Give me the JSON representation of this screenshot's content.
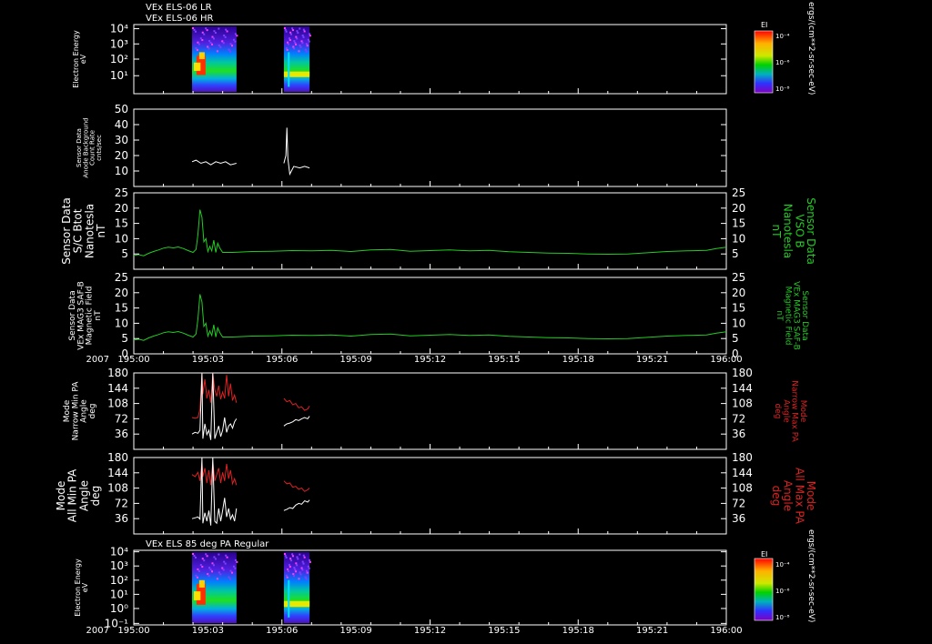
{
  "header": {
    "line1": "VEx ELS-06 LR",
    "line2": "VEx ELS-06 HR"
  },
  "x_axis": {
    "year": "2007",
    "ticks": [
      "195:00",
      "195:03",
      "195:06",
      "195:09",
      "195:12",
      "195:15",
      "195:18",
      "195:21",
      "196:00"
    ]
  },
  "colors": {
    "background": "#000000",
    "white": "#ffffff",
    "green": "#22cc22",
    "red": "#dd2222"
  },
  "colorbar": {
    "label": "EI",
    "ticks": [
      "10⁻⁴",
      "10⁻⁶",
      "10⁻⁸"
    ],
    "units": "ergs/(cm**2-sr-sec-eV)"
  },
  "panels": [
    {
      "id": "spectrogram-1",
      "ylabel": [
        "Electron Energy",
        "eV"
      ],
      "yticks": [
        "10⁴",
        "10³",
        "10²",
        "10¹"
      ]
    },
    {
      "id": "anode-background",
      "ylabel": [
        "Sensor Data",
        "Anode Background",
        "Count Rate",
        "cnts/sec"
      ],
      "yticks": [
        "50",
        "40",
        "30",
        "20",
        "10"
      ]
    },
    {
      "id": "btot",
      "ylabel": [
        "Sensor Data",
        "S/C Btot",
        "Nanotesla",
        "nT"
      ],
      "right_label": [
        "Sensor Data",
        "VSO B",
        "Nanotesla",
        "nT"
      ],
      "yticks": [
        "25",
        "20",
        "15",
        "10",
        "5"
      ]
    },
    {
      "id": "mag-saf",
      "ylabel": [
        "Sensor Data",
        "VEx MAG3 SAF-B",
        "Magnetic Field",
        "nT"
      ],
      "right_label": [
        "Sensor Data",
        "VEx MAG3 SAF-B",
        "Magnetic Field",
        "nT"
      ],
      "yticks": [
        "25",
        "20",
        "15",
        "10",
        "5",
        "0"
      ]
    },
    {
      "id": "narrow-pa",
      "ylabel": [
        "Mode",
        "Narrow Min PA",
        "Angle",
        "deg"
      ],
      "right_label": [
        "Mode",
        "Narrow Max PA",
        "Angle",
        "deg"
      ],
      "yticks": [
        "180",
        "144",
        "108",
        "72",
        "36"
      ]
    },
    {
      "id": "all-pa",
      "ylabel": [
        "Mode",
        "All Min PA",
        "Angle",
        "deg"
      ],
      "right_label": [
        "Mode",
        "All Max PA",
        "Angle",
        "deg"
      ],
      "yticks": [
        "180",
        "144",
        "108",
        "72",
        "36"
      ]
    },
    {
      "id": "spectrogram-2",
      "title": "VEx ELS 85 deg PA Regular",
      "ylabel": [
        "Electron Energy",
        "eV"
      ],
      "yticks": [
        "10⁴",
        "10³",
        "10²",
        "10¹",
        "10⁰",
        "10⁻¹"
      ]
    }
  ],
  "chart_data": [
    {
      "type": "heatmap",
      "name": "VEx ELS-06 LR / HR",
      "x_range": [
        "195:00",
        "196:00"
      ],
      "ylim_log10": [
        0,
        4
      ],
      "data_segments": [
        [
          "195:05.9",
          "195:10.4"
        ],
        [
          "195:15.2",
          "195:17.8"
        ]
      ]
    },
    {
      "type": "line",
      "ylim": [
        0,
        50
      ],
      "segments": [
        {
          "x": [
            5.9,
            6.3,
            6.8,
            7.3,
            7.8,
            8.3,
            8.8,
            9.3,
            9.8,
            10.4
          ],
          "y": [
            16,
            17,
            15,
            16,
            14,
            16,
            15,
            16,
            14,
            15
          ]
        },
        {
          "x": [
            15.2,
            15.4,
            15.5,
            15.6,
            15.8,
            16.2,
            16.8,
            17.3,
            17.8
          ],
          "y": [
            15,
            20,
            38,
            18,
            8,
            13,
            12,
            13,
            12
          ]
        }
      ]
    },
    {
      "type": "line",
      "ylim": [
        0,
        25
      ],
      "x": [
        0,
        0.5,
        1,
        1.5,
        2,
        2.5,
        3,
        3.5,
        4,
        4.5,
        5,
        5.5,
        6,
        6.3,
        6.5,
        6.7,
        6.9,
        7.1,
        7.3,
        7.5,
        7.7,
        7.9,
        8.1,
        8.3,
        8.5,
        8.7,
        9,
        10,
        12,
        14,
        16,
        18,
        20,
        22,
        24,
        26,
        28,
        30,
        32,
        34,
        36,
        38,
        40,
        42,
        44,
        46,
        48,
        50,
        52,
        54,
        56,
        58,
        59,
        60
      ],
      "y": [
        4.5,
        4.8,
        4.4,
        5.2,
        5.8,
        6.3,
        6.9,
        7.2,
        7.0,
        7.3,
        6.8,
        6.1,
        5.5,
        6.5,
        11.5,
        19.5,
        17,
        9,
        10,
        5.8,
        7.5,
        6,
        9.5,
        5.5,
        8.5,
        7,
        5.5,
        5.5,
        5.8,
        5.9,
        6.1,
        6.0,
        6.2,
        5.8,
        6.3,
        6.5,
        5.9,
        6.1,
        6.3,
        6.0,
        6.2,
        5.7,
        5.5,
        5.3,
        5.2,
        5.0,
        4.9,
        5.0,
        5.4,
        5.8,
        6.0,
        6.2,
        6.8,
        7.2
      ]
    },
    {
      "type": "line",
      "ylim": [
        0,
        25
      ],
      "x": [
        0,
        0.5,
        1,
        1.5,
        2,
        2.5,
        3,
        3.5,
        4,
        4.5,
        5,
        5.5,
        6,
        6.3,
        6.5,
        6.7,
        6.9,
        7.1,
        7.3,
        7.5,
        7.7,
        7.9,
        8.1,
        8.3,
        8.5,
        8.7,
        9,
        10,
        12,
        14,
        16,
        18,
        20,
        22,
        24,
        26,
        28,
        30,
        32,
        34,
        36,
        38,
        40,
        42,
        44,
        46,
        48,
        50,
        52,
        54,
        56,
        58,
        59,
        60
      ],
      "y": [
        4.5,
        4.8,
        4.4,
        5.2,
        5.8,
        6.3,
        6.9,
        7.2,
        7.0,
        7.3,
        6.8,
        6.1,
        5.5,
        6.5,
        11.5,
        19.5,
        17,
        9,
        10,
        5.8,
        7.5,
        6,
        9.5,
        5.5,
        8.5,
        7,
        5.5,
        5.5,
        5.8,
        5.9,
        6.1,
        6.0,
        6.2,
        5.8,
        6.3,
        6.5,
        5.9,
        6.1,
        6.3,
        6.0,
        6.2,
        5.7,
        5.5,
        5.3,
        5.2,
        5.0,
        4.9,
        5.0,
        5.4,
        5.8,
        6.0,
        6.2,
        6.8,
        7.2
      ]
    },
    {
      "type": "line",
      "ylim": [
        0,
        180
      ],
      "series": [
        {
          "color": "red",
          "segments": [
            {
              "x": [
                5.9,
                6.2,
                6.5,
                6.7,
                6.9,
                7.0,
                7.2,
                7.4,
                7.6,
                7.8,
                8.0,
                8.2,
                8.4,
                8.6,
                8.8,
                9.0,
                9.2,
                9.4,
                9.6,
                9.8,
                10.0,
                10.2,
                10.4
              ],
              "y": [
                75,
                73,
                75,
                95,
                180,
                130,
                165,
                120,
                140,
                110,
                180,
                140,
                125,
                150,
                118,
                135,
                120,
                175,
                125,
                155,
                115,
                128,
                110
              ]
            },
            {
              "x": [
                15.2,
                15.5,
                15.8,
                16.1,
                16.4,
                16.7,
                17.0,
                17.3,
                17.6,
                17.8
              ],
              "y": [
                120,
                112,
                115,
                105,
                108,
                98,
                100,
                92,
                95,
                102
              ]
            }
          ]
        },
        {
          "color": "white",
          "segments": [
            {
              "x": [
                5.9,
                6.2,
                6.5,
                6.7,
                6.9,
                7.0,
                7.2,
                7.4,
                7.6,
                7.8,
                8.0,
                8.2,
                8.4,
                8.6,
                8.8,
                9.0,
                9.2,
                9.4,
                9.6,
                9.8,
                10.0,
                10.2,
                10.4
              ],
              "y": [
                36,
                40,
                38,
                45,
                180,
                25,
                60,
                35,
                45,
                22,
                180,
                25,
                40,
                55,
                30,
                45,
                75,
                40,
                55,
                60,
                50,
                65,
                72
              ]
            },
            {
              "x": [
                15.2,
                15.5,
                15.8,
                16.1,
                16.4,
                16.7,
                17.0,
                17.3,
                17.6,
                17.8
              ],
              "y": [
                55,
                60,
                62,
                65,
                70,
                68,
                72,
                75,
                72,
                78
              ]
            }
          ]
        }
      ]
    },
    {
      "type": "line",
      "ylim": [
        0,
        180
      ],
      "series": [
        {
          "color": "red",
          "segments": [
            {
              "x": [
                5.9,
                6.2,
                6.5,
                6.7,
                6.9,
                7.0,
                7.2,
                7.4,
                7.6,
                7.8,
                8.0,
                8.2,
                8.4,
                8.6,
                8.8,
                9.0,
                9.2,
                9.4,
                9.6,
                9.8,
                10.0,
                10.2,
                10.4
              ],
              "y": [
                140,
                135,
                145,
                125,
                170,
                135,
                155,
                120,
                150,
                115,
                170,
                125,
                140,
                155,
                120,
                145,
                125,
                165,
                130,
                150,
                118,
                130,
                115
              ]
            },
            {
              "x": [
                15.2,
                15.5,
                15.8,
                16.1,
                16.4,
                16.7,
                17.0,
                17.3,
                17.6,
                17.8
              ],
              "y": [
                125,
                118,
                120,
                110,
                112,
                105,
                108,
                100,
                104,
                108
              ]
            }
          ]
        },
        {
          "color": "white",
          "segments": [
            {
              "x": [
                5.9,
                6.2,
                6.5,
                6.7,
                6.9,
                7.0,
                7.2,
                7.4,
                7.6,
                7.8,
                8.0,
                8.2,
                8.4,
                8.6,
                8.8,
                9.0,
                9.2,
                9.4,
                9.6,
                9.8,
                10.0,
                10.2,
                10.4
              ],
              "y": [
                36,
                38,
                40,
                35,
                180,
                25,
                50,
                30,
                55,
                20,
                180,
                30,
                25,
                60,
                30,
                55,
                85,
                40,
                60,
                35,
                45,
                30,
                60
              ]
            },
            {
              "x": [
                15.2,
                15.5,
                15.8,
                16.1,
                16.4,
                16.7,
                17.0,
                17.3,
                17.6,
                17.8
              ],
              "y": [
                55,
                58,
                62,
                60,
                68,
                72,
                70,
                78,
                75,
                80
              ]
            }
          ]
        }
      ]
    },
    {
      "type": "heatmap",
      "name": "VEx ELS 85 deg PA Regular",
      "x_range": [
        "195:00",
        "196:00"
      ],
      "ylim_log10": [
        -1,
        4
      ],
      "data_segments": [
        [
          "195:05.9",
          "195:10.4"
        ],
        [
          "195:15.2",
          "195:17.8"
        ]
      ]
    }
  ]
}
